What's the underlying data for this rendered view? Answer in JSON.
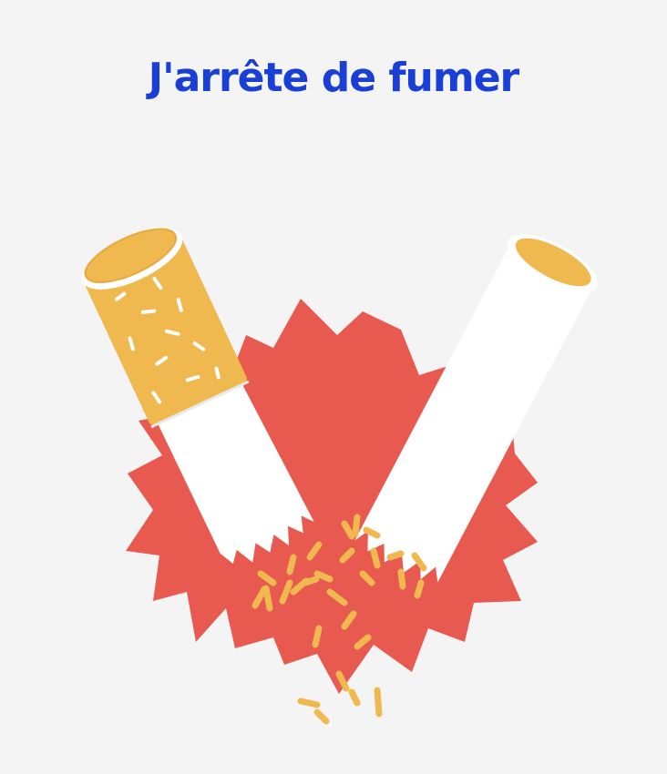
{
  "page": {
    "title": "J'arrête de fumer"
  },
  "illustration": {
    "icon": "broken-cigarette-icon",
    "colors": {
      "background": "#f5f4f4",
      "title": "#1a3fd6",
      "burst": "#e85a4f",
      "filter": "#efb94f",
      "filter_dark": "#e8a93c",
      "paper": "#ffffff",
      "tobacco": "#efb94f"
    }
  }
}
